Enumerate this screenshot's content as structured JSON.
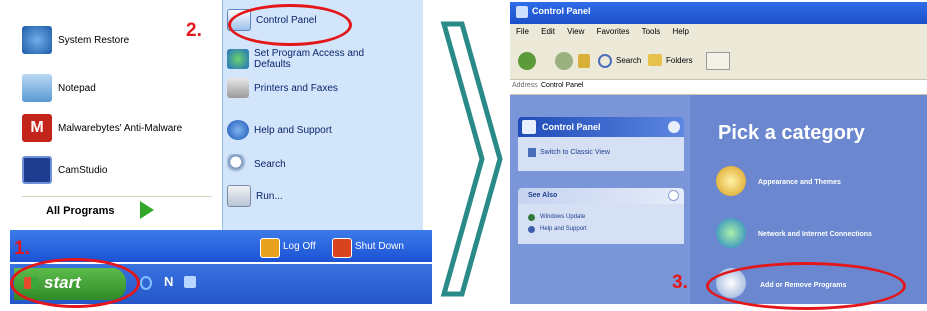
{
  "start_menu": {
    "left_items": [
      {
        "label": "System Restore"
      },
      {
        "label": "Notepad"
      },
      {
        "label": "Malwarebytes' Anti-Malware"
      },
      {
        "label": "CamStudio"
      }
    ],
    "all_programs": "All Programs",
    "right_items": [
      {
        "label": "Control Panel"
      },
      {
        "label": "Set Program Access and Defaults"
      },
      {
        "label": "Printers and Faxes"
      },
      {
        "label": "Help and Support"
      },
      {
        "label": "Search"
      },
      {
        "label": "Run..."
      }
    ],
    "log_off": "Log Off",
    "shut_down": "Shut Down"
  },
  "taskbar": {
    "start_label": "start",
    "quick_launch": "N"
  },
  "control_panel": {
    "title": "Control Panel",
    "menu": [
      "File",
      "Edit",
      "View",
      "Favorites",
      "Tools",
      "Help"
    ],
    "toolbar": {
      "search": "Search",
      "folders": "Folders"
    },
    "address_label": "Address",
    "address_value": "Control Panel",
    "side_panel": {
      "title": "Control Panel",
      "switch_view": "Switch to Classic View",
      "see_also_title": "See Also",
      "see_also_links": [
        "Windows Update",
        "Help and Support"
      ]
    },
    "heading": "Pick a category",
    "categories": [
      {
        "label": "Appearance and Themes"
      },
      {
        "label": "Network and Internet Connections"
      },
      {
        "label": "Add or Remove Programs"
      }
    ]
  },
  "annotations": {
    "step1": "1.",
    "step2": "2.",
    "step3": "3."
  },
  "colors": {
    "annotation_red": "#e3171a",
    "xp_blue": "#2456c8",
    "start_green": "#3a9a2e",
    "arrow_teal": "#2a8a88"
  }
}
